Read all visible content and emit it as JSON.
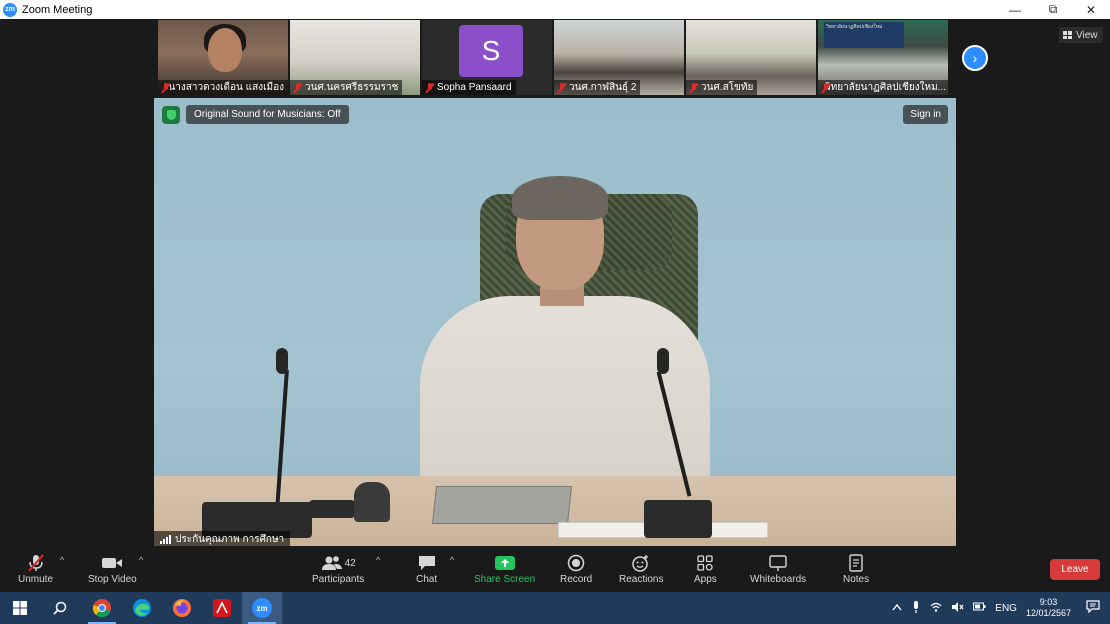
{
  "window": {
    "title": "Zoom Meeting",
    "logo_text": "zm"
  },
  "window_controls": {
    "minimize": "—",
    "restore": "⧉",
    "close": "✕"
  },
  "thumbnails": [
    {
      "name": "นางสาวดวงเดือน แสงเมือง"
    },
    {
      "name": "วนศ.นครศรีธรรมราช"
    },
    {
      "name": "Sopha Pansaard",
      "initial": "S"
    },
    {
      "name": "วนศ.กาฬสินธุ์ 2"
    },
    {
      "name": "วนศ.สโขทัย"
    },
    {
      "name": "วิทยาลัยนาฏศิลปเชียงใหม..."
    }
  ],
  "thumb6_banner": "วิทยาลัยนาฏศิลปเชียงใหม่",
  "nav": {
    "next_glyph": "›",
    "view_label": "View"
  },
  "main_video": {
    "original_sound": "Original Sound for Musicians: Off",
    "sign_in": "Sign in",
    "speaker_name": "ประกันคุณภาพ การศึกษา"
  },
  "toolbar": {
    "unmute": "Unmute",
    "stop_video": "Stop Video",
    "participants": "Participants",
    "participants_count": "42",
    "chat": "Chat",
    "share_screen": "Share Screen",
    "record": "Record",
    "reactions": "Reactions",
    "apps": "Apps",
    "whiteboards": "Whiteboards",
    "notes": "Notes",
    "leave": "Leave",
    "caret": "^"
  },
  "taskbar": {
    "lang": "ENG",
    "time": "9:03",
    "date": "12/01/2567"
  },
  "colors": {
    "zoom_blue": "#2d8cff",
    "share_green": "#22c55e",
    "leave_red": "#d73a3a",
    "taskbar": "#203a5c"
  }
}
